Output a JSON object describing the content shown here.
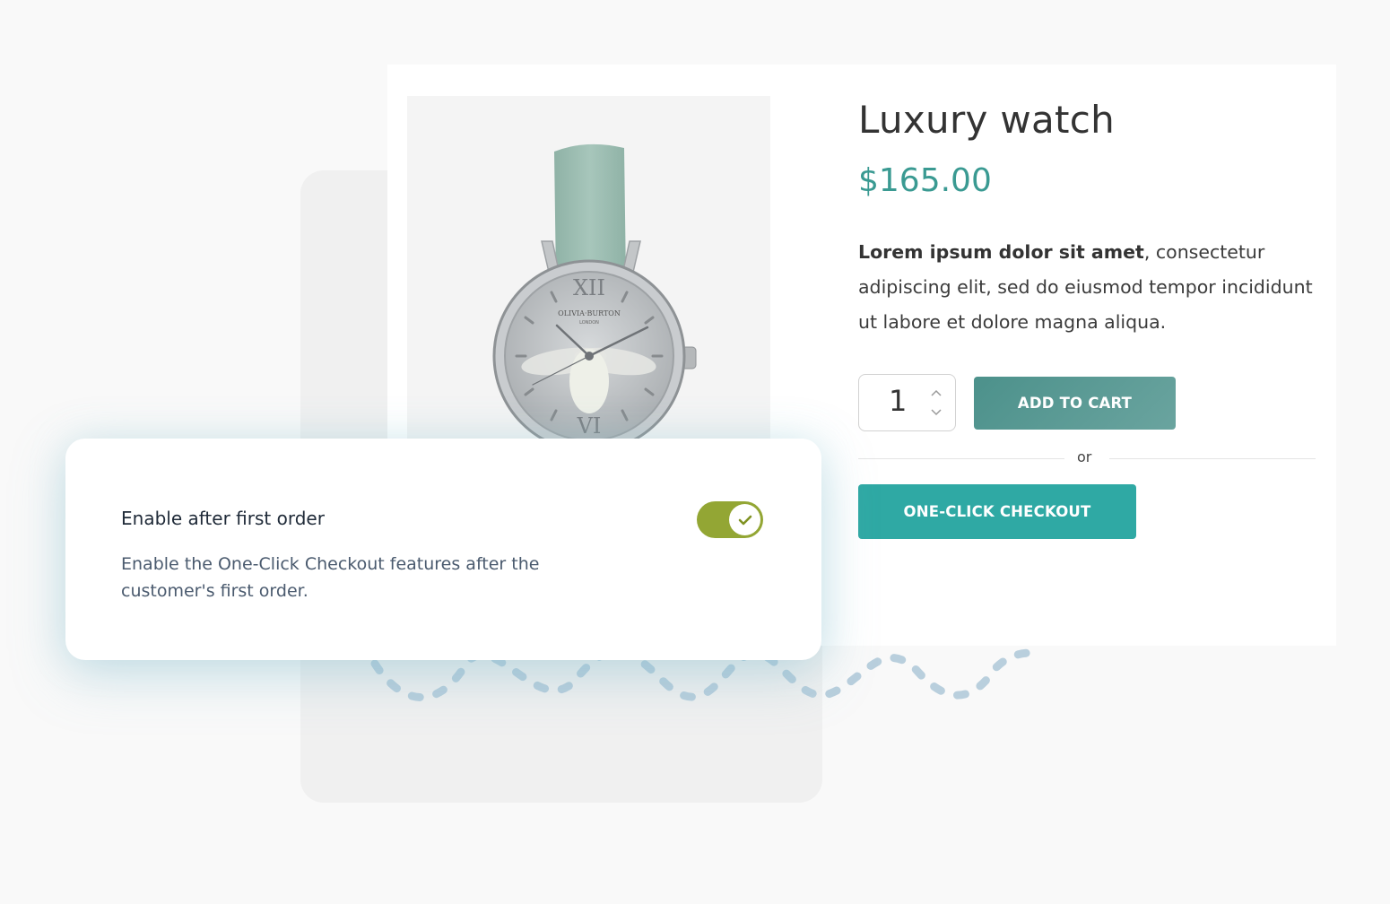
{
  "product": {
    "title": "Luxury watch",
    "price": "$165.00",
    "description_bold": "Lorem ipsum dolor sit amet",
    "description_rest": ", consectetur adipiscing elit, sed do eiusmod tempor incididunt ut labore et dolore magna aliqua.",
    "quantity": "1",
    "add_to_cart_label": "ADD TO CART",
    "or_label": "or",
    "one_click_label": "ONE-CLICK CHECKOUT",
    "watch_brand": "OLIVIA·BURTON",
    "watch_city": "LONDON",
    "numeral_top": "XII",
    "numeral_bottom": "VI"
  },
  "setting": {
    "title": "Enable after first order",
    "description": "Enable the One-Click Checkout features after the customer's first order.",
    "enabled": true,
    "toggle_color": "#93a634"
  },
  "colors": {
    "price": "#3a9a92",
    "add_to_cart": "#5a9b95",
    "one_click": "#2fa9a4"
  },
  "icons": [
    "chevron-up-icon",
    "chevron-down-icon",
    "check-icon"
  ]
}
